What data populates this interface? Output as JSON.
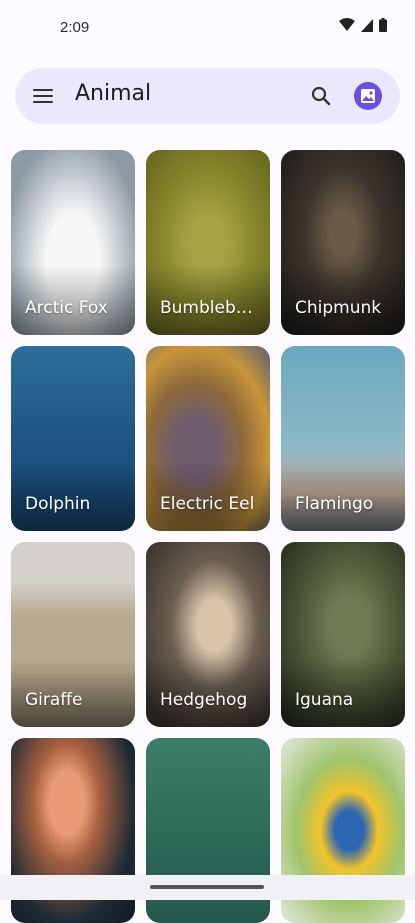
{
  "status": {
    "time": "2:09"
  },
  "app_bar": {
    "title": "Animal"
  },
  "icons": {
    "menu": "hamburger-menu-icon",
    "search": "search-icon",
    "avatar": "photo-avatar-icon",
    "wifi": "wifi-icon",
    "signal": "cell-signal-icon",
    "battery": "battery-icon"
  },
  "colors": {
    "accent": "#6a4fe0",
    "search_bar_bg": "#ece8fb"
  },
  "animals": [
    {
      "label": "Arctic Fox"
    },
    {
      "label": "Bumbleb…"
    },
    {
      "label": "Chipmunk"
    },
    {
      "label": "Dolphin"
    },
    {
      "label": "Electric Eel"
    },
    {
      "label": "Flamingo"
    },
    {
      "label": "Giraffe"
    },
    {
      "label": "Hedgehog"
    },
    {
      "label": "Iguana"
    },
    {
      "label": ""
    },
    {
      "label": ""
    },
    {
      "label": ""
    }
  ]
}
